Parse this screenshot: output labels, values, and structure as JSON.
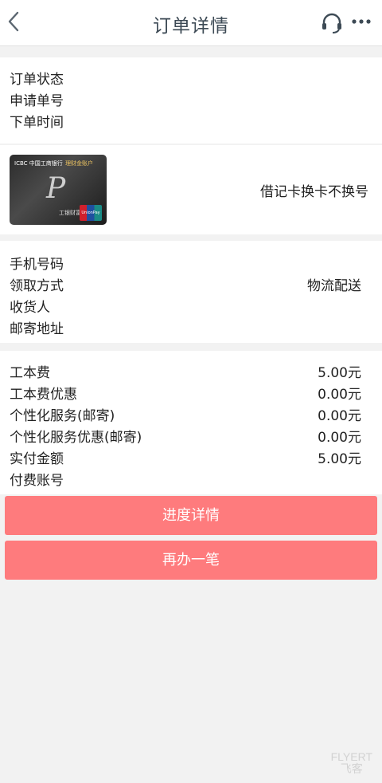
{
  "header": {
    "title": "订单详情",
    "back_icon": "chevron-left-icon",
    "support_icon": "headset-icon",
    "more_icon": "more-dots-icon"
  },
  "order_info": {
    "status_label": "订单状态",
    "application_no_label": "申请单号",
    "order_time_label": "下单时间"
  },
  "card": {
    "bank_text": "ICBC 中国工商银行",
    "tag_text": "理财金账户",
    "sub_text": "工银财富",
    "logo_text": "UnionPay 银联",
    "description": "借记卡换卡不换号"
  },
  "delivery": {
    "phone_label": "手机号码",
    "method_label": "领取方式",
    "method_value": "物流配送",
    "recipient_label": "收货人",
    "address_label": "邮寄地址"
  },
  "fees": {
    "rows": [
      {
        "label": "工本费",
        "value": "5.00元"
      },
      {
        "label": "工本费优惠",
        "value": "0.00元"
      },
      {
        "label": "个性化服务(邮寄)",
        "value": "0.00元"
      },
      {
        "label": "个性化服务优惠(邮寄)",
        "value": "0.00元"
      },
      {
        "label": "实付金额",
        "value": "5.00元"
      },
      {
        "label": "付费账号",
        "value": ""
      }
    ]
  },
  "buttons": {
    "progress": "进度详情",
    "again": "再办一笔"
  },
  "watermark": {
    "line1": "FLYERT",
    "line2": "飞客"
  },
  "colors": {
    "accent": "#fe7b7d",
    "title": "#3d4a55",
    "background": "#f2f2f2"
  }
}
